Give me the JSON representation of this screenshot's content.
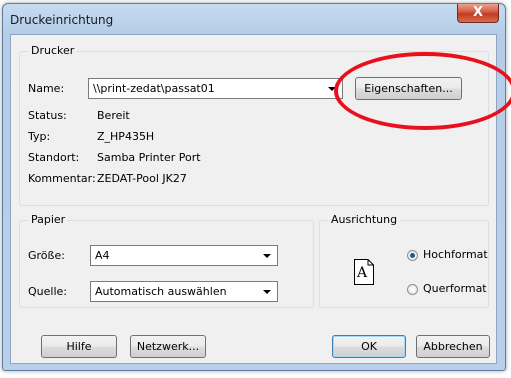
{
  "window": {
    "title": "Druckeinrichtung",
    "close_symbol": "X"
  },
  "printer": {
    "group_label": "Drucker",
    "name_label": "Name:",
    "name_value": "\\\\print-zedat\\passat01",
    "properties_button": "Eigenschaften...",
    "status_label": "Status:",
    "status_value": "Bereit",
    "type_label": "Typ:",
    "type_value": "Z_HP435H",
    "location_label": "Standort:",
    "location_value": "Samba Printer Port",
    "comment_label": "Kommentar:",
    "comment_value": "ZEDAT-Pool JK27"
  },
  "paper": {
    "group_label": "Papier",
    "size_label": "Größe:",
    "size_value": "A4",
    "source_label": "Quelle:",
    "source_value": "Automatisch auswählen"
  },
  "orientation": {
    "group_label": "Ausrichtung",
    "page_icon_letter": "A",
    "portrait_label": "Hochformat",
    "landscape_label": "Querformat",
    "selected": "Hochformat"
  },
  "buttons": {
    "help": "Hilfe",
    "network": "Netzwerk...",
    "ok": "OK",
    "cancel": "Abbrechen"
  },
  "annotation": {
    "highlight_color": "#e8101c"
  },
  "icons": {
    "close": "close-icon",
    "dropdown": "chevron-down-icon",
    "page": "portrait-page-icon"
  }
}
